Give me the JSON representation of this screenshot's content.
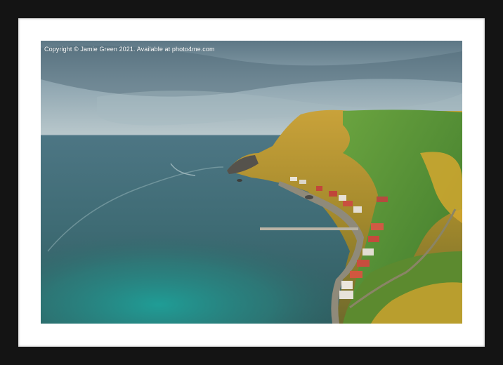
{
  "copyright": "Copyright © Jamie Green 2021. Available at photo4me.com",
  "colors": {
    "frame": "#141414",
    "mat": "#ffffff",
    "sea": "#3f6e77",
    "shallow_sea": "#2a9a94",
    "sky": "#8fa7b3",
    "gorse": "#d7a632",
    "grass": "#5e9a3a"
  }
}
